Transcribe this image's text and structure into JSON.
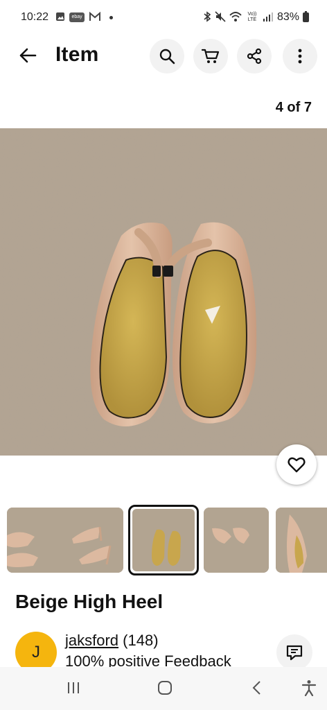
{
  "status_bar": {
    "time": "10:22",
    "battery": "83%",
    "icons": [
      "gallery-icon",
      "ebay-icon",
      "gmail-icon",
      "bluetooth-icon",
      "mute-icon",
      "wifi-icon",
      "volte-icon",
      "signal-icon",
      "battery-icon"
    ],
    "ebay_badge": "ebay",
    "volte_label": "Vo)) LTE"
  },
  "top_bar": {
    "title": "Item",
    "actions": [
      "search-icon",
      "cart-icon",
      "share-icon",
      "more-icon"
    ]
  },
  "gallery": {
    "counter": "4 of 7",
    "thumbnail_count": 5,
    "selected_index": 2
  },
  "item": {
    "title": "Beige High Heel"
  },
  "seller": {
    "avatar_letter": "J",
    "name": "jaksford",
    "score": "(148)",
    "feedback": "100% positive Feedback"
  },
  "nav_bar": {
    "buttons": [
      "recents-icon",
      "home-icon",
      "back-icon",
      "accessibility-icon"
    ]
  },
  "colors": {
    "accent_avatar": "#f5b50e",
    "carpet": "#b3a592",
    "shoe_nude": "#d8b59c",
    "insole": "#c5a64b"
  }
}
